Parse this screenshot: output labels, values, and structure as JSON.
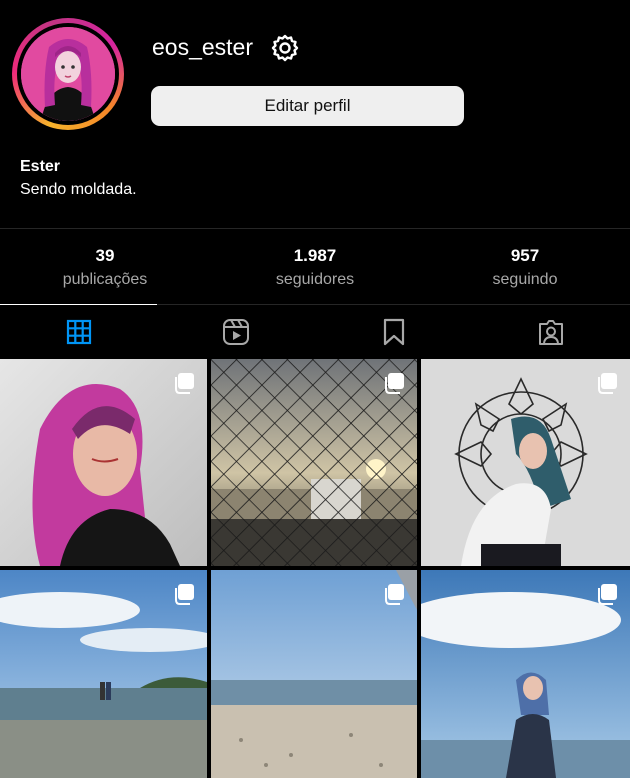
{
  "profile": {
    "username": "eos_ester",
    "edit_label": "Editar perfil",
    "name": "Ester",
    "bio": "Sendo moldada."
  },
  "stats": [
    {
      "value": "39",
      "label": "publicações"
    },
    {
      "value": "1.987",
      "label": "seguidores"
    },
    {
      "value": "957",
      "label": "seguindo"
    }
  ],
  "tabs": [
    {
      "icon": "grid-icon",
      "active": true
    },
    {
      "icon": "reels-icon",
      "active": false
    },
    {
      "icon": "bookmark-icon",
      "active": false
    },
    {
      "icon": "tagged-icon",
      "active": false
    }
  ],
  "posts": [
    {
      "scene": "pink-hair-portrait",
      "multi": true
    },
    {
      "scene": "fence-sunset",
      "multi": true
    },
    {
      "scene": "mandala-wall-portrait",
      "multi": true
    },
    {
      "scene": "beach-couple",
      "multi": true
    },
    {
      "scene": "beach-sand",
      "multi": true
    },
    {
      "scene": "beach-girl",
      "multi": true
    }
  ],
  "colors": {
    "accent_blue": "#0095f6",
    "ring_start": "#f7b32b",
    "ring_end": "#c13584",
    "button_bg": "#efefef",
    "muted_text": "#a8a8a8"
  }
}
